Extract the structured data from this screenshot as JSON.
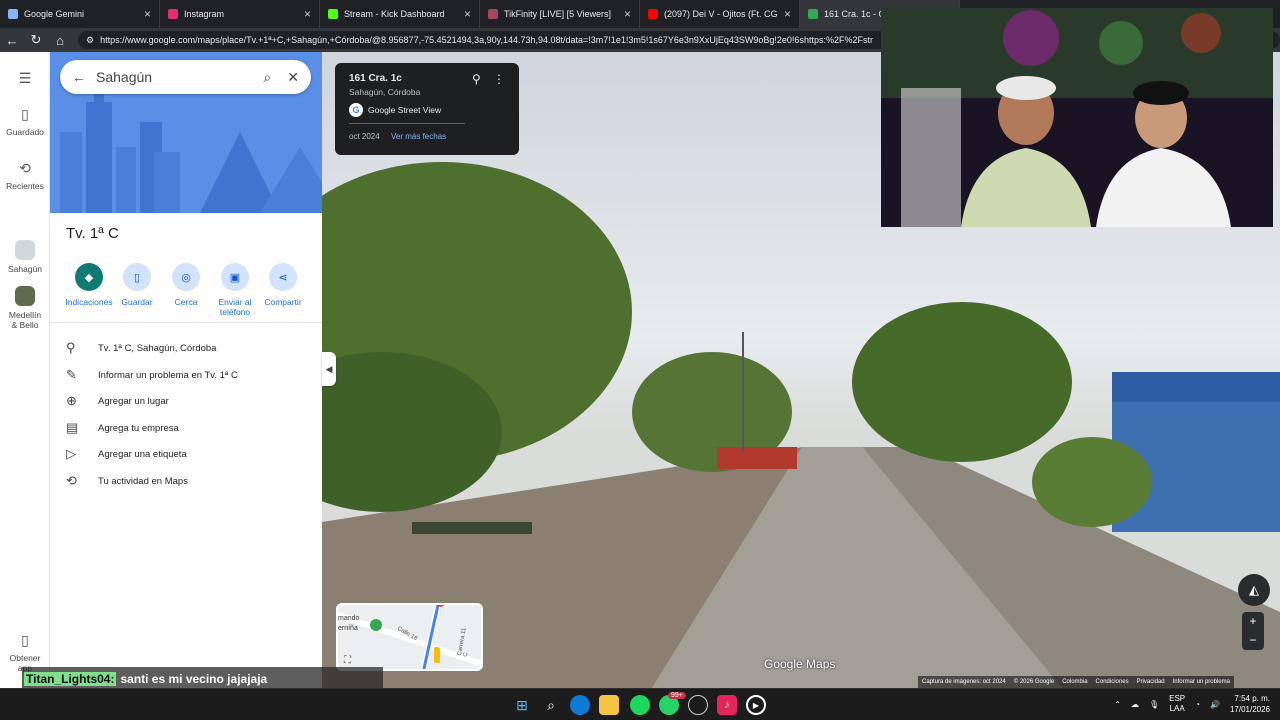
{
  "browser": {
    "tabs": [
      {
        "title": "Google Gemini",
        "active": false,
        "color": "#8ab4f8"
      },
      {
        "title": "Instagram",
        "active": false,
        "color": "#e1306c"
      },
      {
        "title": "Stream - Kick Dashboard",
        "active": false,
        "color": "#53fc18"
      },
      {
        "title": "TikFinity [LIVE] [5 Viewers]",
        "active": false,
        "color": "#a5475b"
      },
      {
        "title": "(2097) Dei V - Ojitos (Ft. CG & Fab",
        "active": false,
        "color": "#ff0000"
      },
      {
        "title": "161 Cra. 1c - Go",
        "active": true,
        "color": "#34a853"
      }
    ],
    "url": "https://www.google.com/maps/place/Tv.+1ª+C,+Sahagún,+Córdoba/@8.956877,-75.4521494,3a,90y,144.73h,94.08t/data=!3m7!1e1!3m5!1s67Y6e3n9XxUjEq43SW9oBg!2e0!6shttps:%2F%2Fstr"
  },
  "maps": {
    "rail": [
      {
        "label": "Guardado",
        "icon": "bookmark-icon"
      },
      {
        "label": "Recientes",
        "icon": "history-icon"
      },
      {
        "label": "Sahagún",
        "icon": "place-thumb"
      },
      {
        "label": "Medellín & Bello",
        "icon": "place-thumb"
      },
      {
        "label": "Obtener app",
        "icon": "phone-icon"
      }
    ],
    "search": {
      "value": "Sahagún"
    },
    "place_title": "Tv. 1ª C",
    "actions": [
      {
        "label": "Indicaciones",
        "icon": "directions-icon"
      },
      {
        "label": "Guardar",
        "icon": "bookmark-icon"
      },
      {
        "label": "Cerca",
        "icon": "nearby-icon"
      },
      {
        "label": "Enviar al teléfono",
        "icon": "send-to-phone-icon"
      },
      {
        "label": "Compartir",
        "icon": "share-icon"
      }
    ],
    "rows": [
      {
        "label": "Tv. 1ª C, Sahagún, Córdoba",
        "icon": "location-pin-icon"
      },
      {
        "label": "Informar un problema en Tv. 1ª C",
        "icon": "pencil-icon"
      },
      {
        "label": "Agregar un lugar",
        "icon": "add-place-icon"
      },
      {
        "label": "Agrega tu empresa",
        "icon": "add-business-icon"
      },
      {
        "label": "Agregar una etiqueta",
        "icon": "label-icon"
      },
      {
        "label": "Tu actividad en Maps",
        "icon": "activity-icon"
      }
    ],
    "street": {
      "address": "161 Cra. 1c",
      "locality": "Sahagún, Córdoba",
      "provider": "Google Street View",
      "date": "oct 2024",
      "more_dates": "Ver más fechas",
      "watermark": "Google Maps",
      "minimap_labels": [
        "mando",
        "erníña",
        "Calle 18",
        "Carrera 11 C"
      ],
      "attribution": [
        "Captura de imágenes: oct 2024",
        "© 2026 Google",
        "Colombia",
        "Condiciones",
        "Privacidad",
        "Informar un problema"
      ]
    }
  },
  "chat": {
    "user": "Titan_Lights04:",
    "message": "santi es mi vecino jajajaja"
  },
  "taskbar": {
    "badge": "99+",
    "lang1": "ESP",
    "lang2": "LAA",
    "time": "7:54 p. m.",
    "date": "17/01/2026"
  }
}
